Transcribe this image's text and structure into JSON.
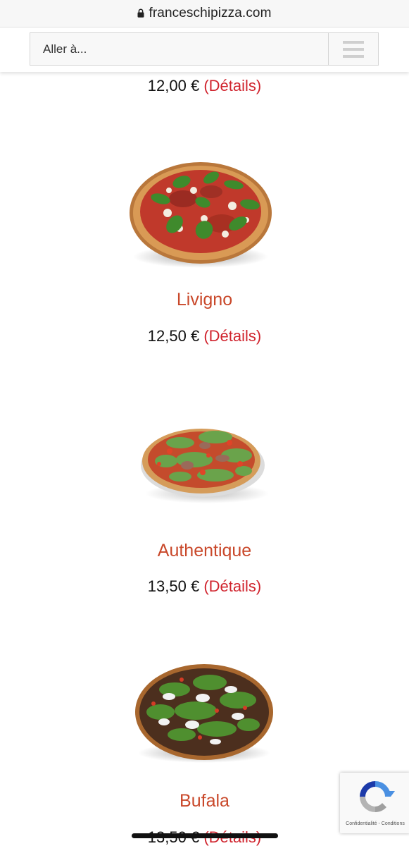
{
  "browser": {
    "url": "franceschipizza.com",
    "lock_icon": "lock-icon"
  },
  "header": {
    "goto_label": "Aller à...",
    "menu_icon": "hamburger-menu-icon"
  },
  "menu_items": [
    {
      "price": "12,00 €",
      "details_label": "(Détails)"
    },
    {
      "name": "Livigno",
      "price": "12,50 €",
      "details_label": "(Détails)"
    },
    {
      "name": "Authentique",
      "price": "13,50 €",
      "details_label": "(Détails)"
    },
    {
      "name": "Bufala",
      "price": "13,50 €",
      "details_label": "(Détails)"
    }
  ],
  "recaptcha": {
    "privacy_label": "Confidentialité",
    "separator": "-",
    "terms_label": "Conditions"
  },
  "colors": {
    "name_color": "#c9482a",
    "details_color": "#d0232d"
  }
}
